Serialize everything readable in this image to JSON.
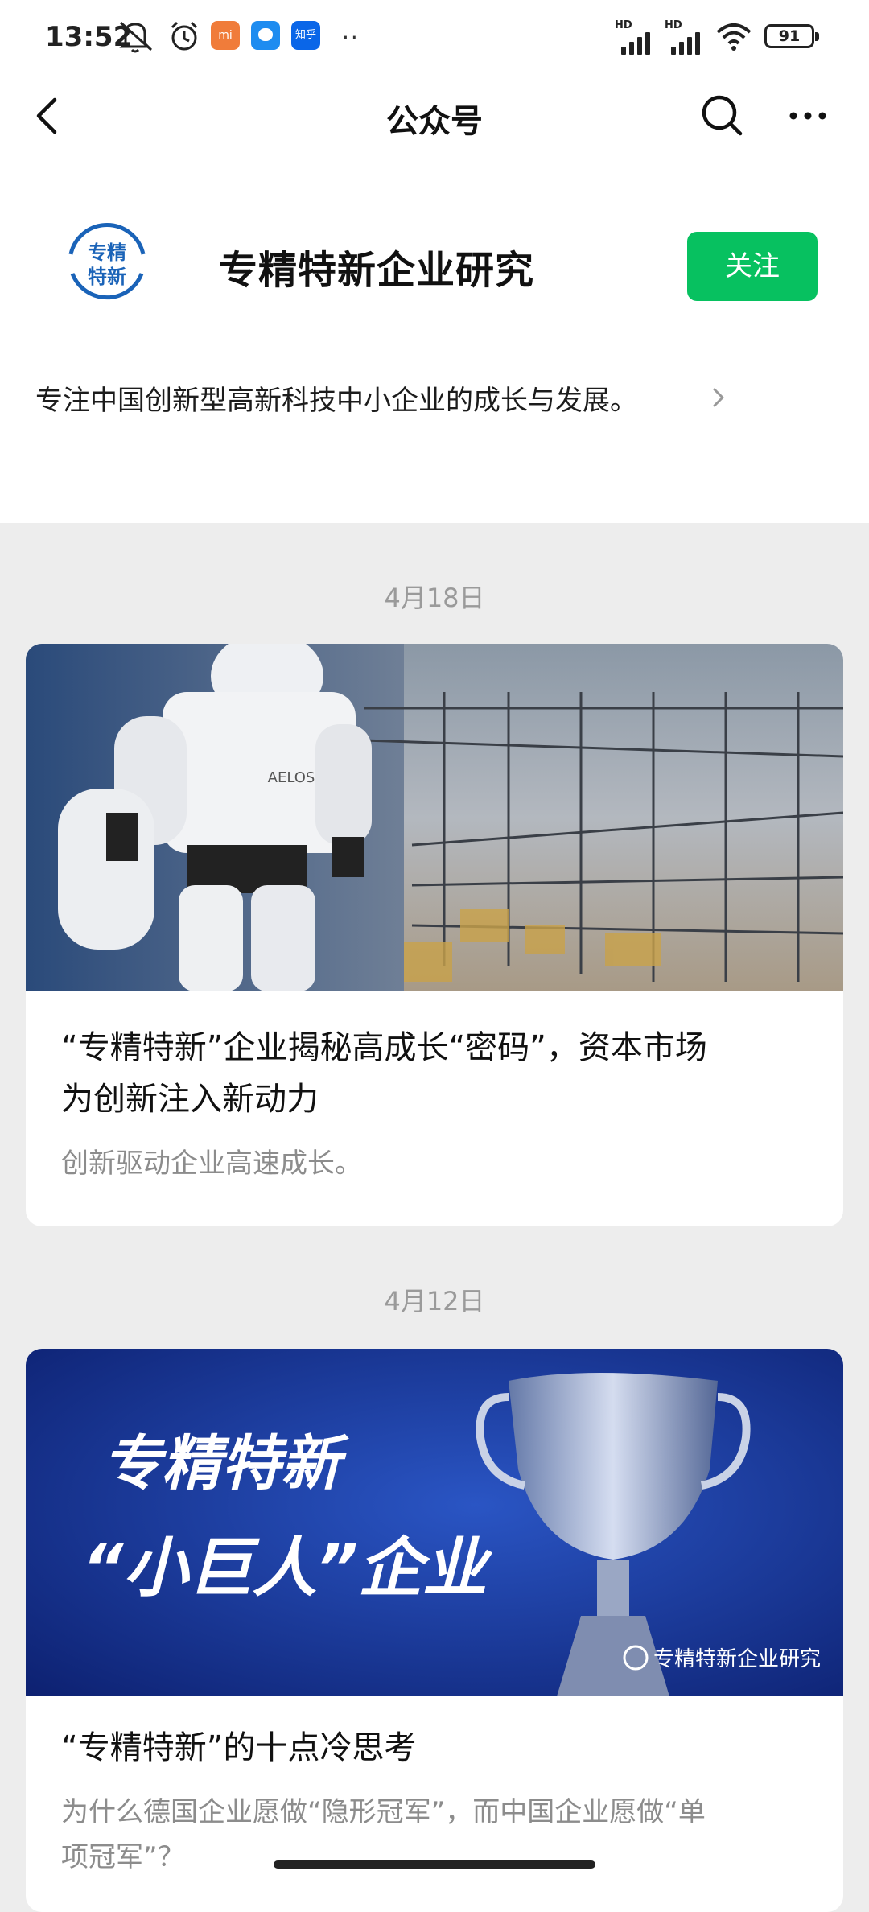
{
  "status_bar": {
    "time": "13:52",
    "hd_label": "HD",
    "battery": "91",
    "app_mi": "mi",
    "app_zhihu": "知乎",
    "more": "··"
  },
  "nav": {
    "title": "公众号",
    "back_icon": "chevron-left",
    "search_icon": "search",
    "more_icon": "more-horizontal"
  },
  "account": {
    "avatar_text": [
      "专精",
      "特新"
    ],
    "name": "专精特新企业研究",
    "follow_label": "关注",
    "description": "专注中国创新型高新科技中小企业的成长与发展。",
    "brand_color": "#07c160"
  },
  "articles": [
    {
      "date": "4月18日",
      "image_text": "AELOS",
      "title_line1": "“专精特新”企业揭秘高成长“密码”，资本市场",
      "title_line2": "为创新注入新动力",
      "summary": "创新驱动企业高速成长。"
    },
    {
      "date": "4月12日",
      "image_text_line1": "专精特新",
      "image_text_line2": "“小巨人”企业",
      "watermark": "专精特新企业研究",
      "title_line1": "“专精特新”的十点冷思考",
      "summary_line1": "为什么德国企业愿做“隐形冠军”，而中国企业愿做“单",
      "summary_line2": "项冠军”？"
    }
  ]
}
